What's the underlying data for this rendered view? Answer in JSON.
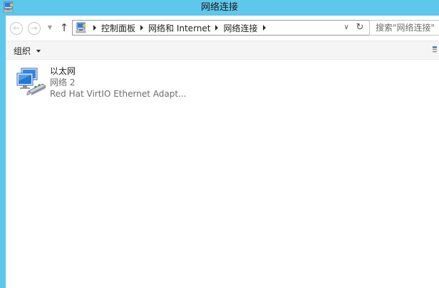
{
  "window": {
    "title": "网络连接"
  },
  "address": {
    "crumbs": [
      "控制面板",
      "网络和 Internet",
      "网络连接"
    ],
    "dropdown_icon": "chevron-down-icon",
    "refresh_icon": "refresh-icon"
  },
  "search": {
    "placeholder": "搜索\"网络连接\""
  },
  "commandbar": {
    "organize_label": "组织"
  },
  "adapter": {
    "name": "以太网",
    "network": "网络  2",
    "device": "Red Hat VirtIO Ethernet Adapt..."
  },
  "colors": {
    "frame": "#5ec7ec",
    "commandbar": "#f5f5f5"
  }
}
